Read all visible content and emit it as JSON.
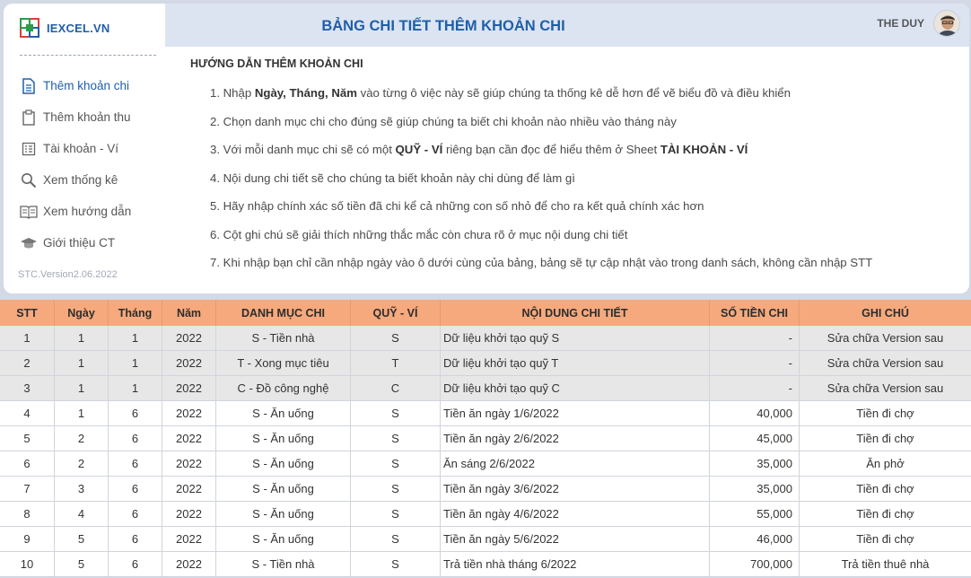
{
  "brand": {
    "name": "IEXCEL.VN"
  },
  "sidebar": {
    "items": [
      {
        "label": "Thêm khoản chi",
        "icon": "document-icon",
        "active": true
      },
      {
        "label": "Thêm khoản thu",
        "icon": "clipboard-icon",
        "active": false
      },
      {
        "label": "Tài khoản - Ví",
        "icon": "ledger-icon",
        "active": false
      },
      {
        "label": "Xem thống kê",
        "icon": "search-icon",
        "active": false
      },
      {
        "label": "Xem hướng dẫn",
        "icon": "book-icon",
        "active": false
      },
      {
        "label": "Giới thiệu CT",
        "icon": "graduation-cap-icon",
        "active": false
      }
    ],
    "version": "STC.Version2.06.2022"
  },
  "header": {
    "title": "BẢNG CHI TIẾT THÊM KHOẢN CHI",
    "user_name": "THE DUY"
  },
  "guide": {
    "title": "HƯỚNG DẪN THÊM KHOẢN CHI",
    "lines": [
      [
        "1. Nhập ",
        "Ngày, Tháng, Năm",
        " vào từng ô việc này sẽ giúp chúng ta thống kê dễ hơn để vẽ biểu đồ và điều khiển"
      ],
      [
        "2. Chọn danh mục chi cho đúng sẽ giúp chúng ta biết chi khoản nào nhiều vào tháng này",
        "",
        ""
      ],
      [
        "3. Với mỗi danh mục chi sẽ có một ",
        "QUỸ - VÍ",
        " riêng bạn cần đọc để hiểu thêm ở Sheet ",
        "TÀI KHOẢN - VÍ"
      ],
      [
        "4. Nội dung chi tiết sẽ cho chúng ta biết khoản này chi dùng để làm gì",
        "",
        ""
      ],
      [
        "5. Hãy nhập chính xác số tiền đã chi kể cả những con số nhỏ để cho ra kết quả chính xác hơn",
        "",
        ""
      ],
      [
        "6. Cột ghi chú sẽ giải thích những thắc mắc còn chưa rõ ở mục nội dung chi tiết",
        "",
        ""
      ],
      [
        "7. Khi nhập bạn chỉ cần nhập ngày vào ô dưới cùng của bảng, bảng sẽ tự cập nhật vào trong danh sách, không cần nhập STT",
        "",
        ""
      ]
    ]
  },
  "colors": {
    "accent": "#1f5fa8",
    "header_bg": "#dce4f2",
    "table_header": "#f5a97d",
    "init_row": "#e7e7e7"
  },
  "table": {
    "columns": [
      "STT",
      "Ngày",
      "Tháng",
      "Năm",
      "DANH MỤC CHI",
      "QUỸ - VÍ",
      "NỘI DUNG CHI TIẾT",
      "SỐ TIỀN CHI",
      "GHI CHÚ"
    ],
    "rows": [
      {
        "kind": "init",
        "cells": [
          "1",
          "1",
          "1",
          "2022",
          "S - Tiền nhà",
          "S",
          "Dữ liệu khởi tạo quỹ S",
          "-",
          "Sửa chữa Version sau"
        ]
      },
      {
        "kind": "init",
        "cells": [
          "2",
          "1",
          "1",
          "2022",
          "T - Xong mục tiêu",
          "T",
          "Dữ liệu khởi tạo quỹ T",
          "-",
          "Sửa chữa Version sau"
        ]
      },
      {
        "kind": "init",
        "cells": [
          "3",
          "1",
          "1",
          "2022",
          "C - Đồ công nghệ",
          "C",
          "Dữ liệu khởi tạo quỹ C",
          "-",
          "Sửa chữa Version sau"
        ]
      },
      {
        "kind": "body",
        "cells": [
          "4",
          "1",
          "6",
          "2022",
          "S - Ăn uống",
          "S",
          "Tiền ăn ngày 1/6/2022",
          "40,000",
          "Tiền đi chợ"
        ]
      },
      {
        "kind": "body",
        "cells": [
          "5",
          "2",
          "6",
          "2022",
          "S - Ăn uống",
          "S",
          "Tiền ăn ngày 2/6/2022",
          "45,000",
          "Tiền đi chợ"
        ]
      },
      {
        "kind": "body",
        "cells": [
          "6",
          "2",
          "6",
          "2022",
          "S - Ăn uống",
          "S",
          "Ăn sáng 2/6/2022",
          "35,000",
          "Ăn phở"
        ]
      },
      {
        "kind": "body",
        "cells": [
          "7",
          "3",
          "6",
          "2022",
          "S - Ăn uống",
          "S",
          "Tiền ăn ngày 3/6/2022",
          "35,000",
          "Tiền đi chợ"
        ]
      },
      {
        "kind": "body",
        "cells": [
          "8",
          "4",
          "6",
          "2022",
          "S - Ăn uống",
          "S",
          "Tiền ăn ngày 4/6/2022",
          "55,000",
          "Tiền đi chợ"
        ]
      },
      {
        "kind": "body",
        "cells": [
          "9",
          "5",
          "6",
          "2022",
          "S - Ăn uống",
          "S",
          "Tiền ăn ngày 5/6/2022",
          "46,000",
          "Tiền đi chợ"
        ]
      },
      {
        "kind": "body",
        "cells": [
          "10",
          "5",
          "6",
          "2022",
          "S - Tiền nhà",
          "S",
          "Trả tiền nhà tháng 6/2022",
          "700,000",
          "Trả tiền thuê nhà"
        ]
      }
    ]
  }
}
